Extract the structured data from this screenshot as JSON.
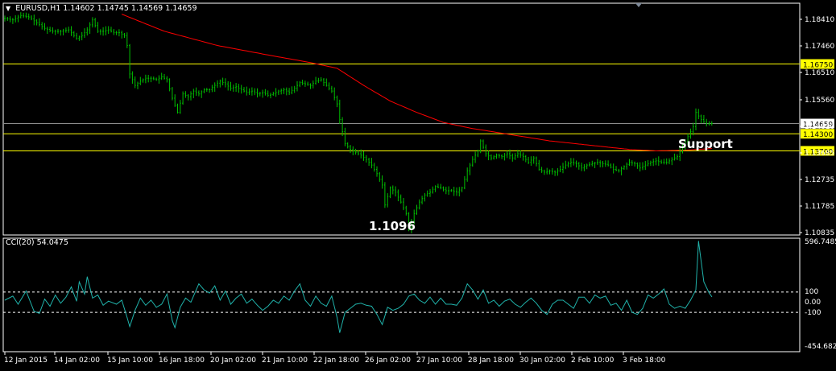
{
  "header": {
    "symbol": "EURUSD,H1",
    "ohlc": "1.14602 1.14745 1.14569 1.14659",
    "arrow_icon": "triangle-down-icon"
  },
  "colors": {
    "background": "#000000",
    "frame": "#ffffff",
    "candles": "#00c000",
    "ma_line": "#ff0000",
    "level_lines": "#ffff00",
    "level_label_bg": "#ffff00",
    "price_tag_bg": "#ffffff",
    "cci_line": "#20b2aa",
    "cci_levels": "#ffffff"
  },
  "chart_data": [
    {
      "type": "line",
      "name": "price_chart",
      "symbol": "EURUSD",
      "timeframe": "H1",
      "ylim": [
        1.1083,
        1.188
      ],
      "yticks": [
        "1.18410",
        "1.17460",
        "1.16510",
        "1.15560",
        "1.14610",
        "1.13685",
        "1.12735",
        "1.11785",
        "1.10835"
      ],
      "xticks": [
        "12 Jan 2015",
        "14 Jan 02:00",
        "15 Jan 10:00",
        "16 Jan 18:00",
        "20 Jan 02:00",
        "21 Jan 10:00",
        "22 Jan 18:00",
        "26 Jan 02:00",
        "27 Jan 10:00",
        "28 Jan 18:00",
        "30 Jan 02:00",
        "2 Feb 10:00",
        "3 Feb 18:00"
      ],
      "price_path": [
        [
          0,
          1.1835
        ],
        [
          3,
          1.183
        ],
        [
          6,
          1.1845
        ],
        [
          9,
          1.184
        ],
        [
          12,
          1.182
        ],
        [
          15,
          1.18
        ],
        [
          18,
          1.179
        ],
        [
          21,
          1.179
        ],
        [
          24,
          1.1795
        ],
        [
          27,
          1.1765
        ],
        [
          29,
          1.1775
        ],
        [
          31,
          1.1795
        ],
        [
          33,
          1.183
        ],
        [
          35,
          1.179
        ],
        [
          37,
          1.179
        ],
        [
          39,
          1.1795
        ],
        [
          41,
          1.1785
        ],
        [
          43,
          1.1785
        ],
        [
          45,
          1.1775
        ],
        [
          46,
          1.174
        ],
        [
          47,
          1.164
        ],
        [
          49,
          1.16
        ],
        [
          51,
          1.1615
        ],
        [
          53,
          1.1625
        ],
        [
          55,
          1.1625
        ],
        [
          57,
          1.162
        ],
        [
          59,
          1.163
        ],
        [
          61,
          1.162
        ],
        [
          63,
          1.1555
        ],
        [
          65,
          1.1505
        ],
        [
          67,
          1.157
        ],
        [
          69,
          1.156
        ],
        [
          71,
          1.158
        ],
        [
          73,
          1.157
        ],
        [
          75,
          1.1585
        ],
        [
          77,
          1.1585
        ],
        [
          79,
          1.16
        ],
        [
          81,
          1.1615
        ],
        [
          83,
          1.1605
        ],
        [
          85,
          1.159
        ],
        [
          87,
          1.1595
        ],
        [
          89,
          1.1585
        ],
        [
          91,
          1.1575
        ],
        [
          93,
          1.158
        ],
        [
          95,
          1.157
        ],
        [
          97,
          1.1575
        ],
        [
          99,
          1.1565
        ],
        [
          101,
          1.157
        ],
        [
          103,
          1.158
        ],
        [
          105,
          1.1585
        ],
        [
          107,
          1.1575
        ],
        [
          109,
          1.159
        ],
        [
          111,
          1.161
        ],
        [
          113,
          1.1605
        ],
        [
          115,
          1.16
        ],
        [
          117,
          1.1615
        ],
        [
          119,
          1.162
        ],
        [
          121,
          1.16
        ],
        [
          123,
          1.158
        ],
        [
          125,
          1.1535
        ],
        [
          126,
          1.148
        ],
        [
          128,
          1.1395
        ],
        [
          130,
          1.1375
        ],
        [
          132,
          1.1365
        ],
        [
          134,
          1.1355
        ],
        [
          136,
          1.134
        ],
        [
          138,
          1.132
        ],
        [
          140,
          1.129
        ],
        [
          142,
          1.125
        ],
        [
          143,
          1.118
        ],
        [
          145,
          1.124
        ],
        [
          147,
          1.1225
        ],
        [
          149,
          1.119
        ],
        [
          151,
          1.115
        ],
        [
          152,
          1.1096
        ],
        [
          154,
          1.115
        ],
        [
          156,
          1.119
        ],
        [
          158,
          1.1215
        ],
        [
          160,
          1.1225
        ],
        [
          162,
          1.1245
        ],
        [
          164,
          1.124
        ],
        [
          166,
          1.123
        ],
        [
          168,
          1.123
        ],
        [
          170,
          1.1225
        ],
        [
          172,
          1.124
        ],
        [
          174,
          1.13
        ],
        [
          176,
          1.134
        ],
        [
          178,
          1.137
        ],
        [
          179,
          1.1405
        ],
        [
          181,
          1.136
        ],
        [
          183,
          1.1345
        ],
        [
          185,
          1.1355
        ],
        [
          187,
          1.135
        ],
        [
          189,
          1.136
        ],
        [
          191,
          1.1345
        ],
        [
          193,
          1.136
        ],
        [
          195,
          1.135
        ],
        [
          197,
          1.133
        ],
        [
          199,
          1.1345
        ],
        [
          201,
          1.1305
        ],
        [
          203,
          1.1295
        ],
        [
          205,
          1.13
        ],
        [
          207,
          1.1295
        ],
        [
          209,
          1.1305
        ],
        [
          211,
          1.132
        ],
        [
          213,
          1.133
        ],
        [
          215,
          1.1325
        ],
        [
          217,
          1.131
        ],
        [
          219,
          1.132
        ],
        [
          221,
          1.1325
        ],
        [
          223,
          1.133
        ],
        [
          225,
          1.1325
        ],
        [
          227,
          1.132
        ],
        [
          229,
          1.1305
        ],
        [
          231,
          1.13
        ],
        [
          233,
          1.1315
        ],
        [
          235,
          1.133
        ],
        [
          237,
          1.1325
        ],
        [
          239,
          1.131
        ],
        [
          241,
          1.132
        ],
        [
          243,
          1.133
        ],
        [
          245,
          1.1335
        ],
        [
          247,
          1.133
        ],
        [
          249,
          1.133
        ],
        [
          251,
          1.134
        ],
        [
          253,
          1.135
        ],
        [
          255,
          1.1385
        ],
        [
          257,
          1.142
        ],
        [
          259,
          1.1455
        ],
        [
          260,
          1.1505
        ],
        [
          262,
          1.148
        ],
        [
          264,
          1.1465
        ],
        [
          266,
          1.1466
        ]
      ],
      "moving_average": [
        [
          44,
          1.185
        ],
        [
          60,
          1.179
        ],
        [
          80,
          1.174
        ],
        [
          100,
          1.1705
        ],
        [
          115,
          1.168
        ],
        [
          125,
          1.166
        ],
        [
          135,
          1.16
        ],
        [
          145,
          1.1545
        ],
        [
          155,
          1.1505
        ],
        [
          165,
          1.147
        ],
        [
          175,
          1.145
        ],
        [
          185,
          1.1435
        ],
        [
          195,
          1.142
        ],
        [
          205,
          1.1405
        ],
        [
          215,
          1.1395
        ],
        [
          225,
          1.1385
        ],
        [
          235,
          1.1375
        ],
        [
          245,
          1.137
        ],
        [
          255,
          1.1372
        ],
        [
          266,
          1.1378
        ]
      ],
      "levels": [
        {
          "price": 1.1675,
          "label": "1.16750"
        },
        {
          "price": 1.143,
          "label": "1.14300"
        },
        {
          "price": 1.137,
          "label": "1.13700"
        }
      ],
      "current_price": {
        "price": 1.14659,
        "label": "1.14659"
      },
      "annotations": [
        {
          "text": "Support",
          "bar": 280,
          "price": 1.14
        },
        {
          "text": "1.1096",
          "bar": 152,
          "price": 1.1096
        }
      ]
    },
    {
      "type": "line",
      "name": "CCI(20)",
      "title": "CCI(20) 54.0475",
      "ylim": [
        -454.6828,
        596.7485
      ],
      "yticks": [
        "596.7485",
        "100",
        "0.00",
        "-100",
        "-454.6828"
      ],
      "levels": [
        100,
        -100
      ],
      "values": [
        [
          0,
          20
        ],
        [
          3,
          60
        ],
        [
          5,
          -20
        ],
        [
          8,
          110
        ],
        [
          11,
          -90
        ],
        [
          13,
          -110
        ],
        [
          15,
          30
        ],
        [
          17,
          -40
        ],
        [
          19,
          70
        ],
        [
          21,
          -10
        ],
        [
          23,
          50
        ],
        [
          25,
          150
        ],
        [
          27,
          10
        ],
        [
          28,
          200
        ],
        [
          30,
          80
        ],
        [
          31,
          250
        ],
        [
          33,
          40
        ],
        [
          35,
          70
        ],
        [
          37,
          -30
        ],
        [
          39,
          10
        ],
        [
          42,
          -20
        ],
        [
          44,
          20
        ],
        [
          46,
          -150
        ],
        [
          47,
          -240
        ],
        [
          49,
          -80
        ],
        [
          51,
          40
        ],
        [
          53,
          -30
        ],
        [
          55,
          20
        ],
        [
          57,
          -50
        ],
        [
          59,
          -20
        ],
        [
          61,
          80
        ],
        [
          63,
          -180
        ],
        [
          64,
          -250
        ],
        [
          66,
          -50
        ],
        [
          68,
          40
        ],
        [
          70,
          0
        ],
        [
          73,
          180
        ],
        [
          75,
          120
        ],
        [
          77,
          90
        ],
        [
          79,
          160
        ],
        [
          81,
          20
        ],
        [
          83,
          110
        ],
        [
          85,
          -20
        ],
        [
          87,
          40
        ],
        [
          89,
          80
        ],
        [
          91,
          -10
        ],
        [
          93,
          30
        ],
        [
          95,
          -30
        ],
        [
          97,
          -80
        ],
        [
          99,
          -40
        ],
        [
          101,
          20
        ],
        [
          103,
          -10
        ],
        [
          105,
          60
        ],
        [
          107,
          20
        ],
        [
          109,
          110
        ],
        [
          111,
          180
        ],
        [
          113,
          20
        ],
        [
          115,
          -40
        ],
        [
          117,
          60
        ],
        [
          119,
          -10
        ],
        [
          121,
          -40
        ],
        [
          123,
          60
        ],
        [
          125,
          -150
        ],
        [
          126,
          -300
        ],
        [
          128,
          -100
        ],
        [
          130,
          -60
        ],
        [
          132,
          -20
        ],
        [
          134,
          -10
        ],
        [
          136,
          -30
        ],
        [
          138,
          -40
        ],
        [
          140,
          -120
        ],
        [
          142,
          -220
        ],
        [
          144,
          -50
        ],
        [
          146,
          -80
        ],
        [
          148,
          -60
        ],
        [
          150,
          -20
        ],
        [
          152,
          60
        ],
        [
          154,
          80
        ],
        [
          156,
          20
        ],
        [
          158,
          -10
        ],
        [
          160,
          50
        ],
        [
          162,
          -20
        ],
        [
          164,
          40
        ],
        [
          166,
          -20
        ],
        [
          168,
          -20
        ],
        [
          170,
          -30
        ],
        [
          172,
          40
        ],
        [
          174,
          180
        ],
        [
          176,
          120
        ],
        [
          178,
          30
        ],
        [
          180,
          120
        ],
        [
          182,
          -10
        ],
        [
          184,
          20
        ],
        [
          186,
          -40
        ],
        [
          188,
          10
        ],
        [
          190,
          30
        ],
        [
          192,
          -20
        ],
        [
          194,
          -50
        ],
        [
          196,
          0
        ],
        [
          198,
          40
        ],
        [
          200,
          -10
        ],
        [
          202,
          -80
        ],
        [
          204,
          -120
        ],
        [
          206,
          -20
        ],
        [
          208,
          20
        ],
        [
          210,
          20
        ],
        [
          212,
          -20
        ],
        [
          214,
          -60
        ],
        [
          216,
          50
        ],
        [
          218,
          50
        ],
        [
          220,
          -10
        ],
        [
          222,
          70
        ],
        [
          224,
          40
        ],
        [
          226,
          60
        ],
        [
          228,
          -30
        ],
        [
          230,
          -10
        ],
        [
          232,
          -80
        ],
        [
          234,
          20
        ],
        [
          236,
          -100
        ],
        [
          238,
          -120
        ],
        [
          240,
          -60
        ],
        [
          242,
          70
        ],
        [
          244,
          40
        ],
        [
          246,
          80
        ],
        [
          248,
          130
        ],
        [
          250,
          -20
        ],
        [
          252,
          -60
        ],
        [
          254,
          -40
        ],
        [
          256,
          -60
        ],
        [
          258,
          20
        ],
        [
          260,
          120
        ],
        [
          261,
          600
        ],
        [
          263,
          200
        ],
        [
          265,
          90
        ],
        [
          266,
          54
        ]
      ]
    }
  ]
}
